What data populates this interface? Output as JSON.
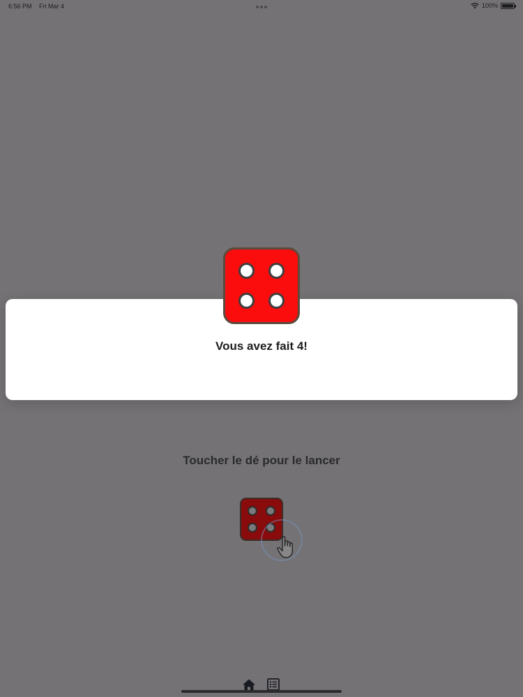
{
  "status_bar": {
    "time": "6:56 PM",
    "date": "Fri Mar 4",
    "battery": "100%"
  },
  "dialog": {
    "message": "Vous avez fait 4!",
    "die_value": 4,
    "die_color": "#fb0d0d"
  },
  "main": {
    "instruction": "Toucher le dé pour le lancer",
    "die_value": 4,
    "die_icon": "die-four-icon",
    "hint_icon": "tap-hand-icon"
  },
  "tab_bar": {
    "items": [
      {
        "icon": "home-icon"
      },
      {
        "icon": "list-icon"
      }
    ]
  },
  "colors": {
    "overlay_background": "#747274",
    "dialog_background": "#ffffff",
    "die_red": "#fb0d0d"
  }
}
